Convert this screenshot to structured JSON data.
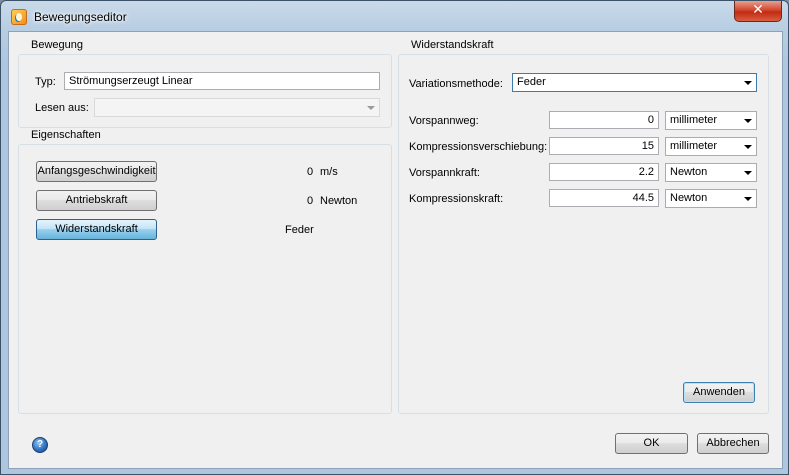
{
  "window": {
    "title": "Bewegungseditor",
    "close_glyph": "✕"
  },
  "bewegung": {
    "legend": "Bewegung",
    "typ_label": "Typ:",
    "typ_value": "Strömungserzeugt Linear",
    "lesen_label": "Lesen aus:",
    "lesen_value": ""
  },
  "eigenschaften": {
    "legend": "Eigenschaften",
    "rows": [
      {
        "button": "Anfangsgeschwindigkeit",
        "value": "0",
        "unit": "m/s"
      },
      {
        "button": "Antriebskraft",
        "value": "0",
        "unit": "Newton"
      },
      {
        "button": "Widerstandskraft",
        "value": "Feder"
      }
    ]
  },
  "widerstand": {
    "legend": "Widerstandskraft",
    "methode_label": "Variationsmethode:",
    "methode_value": "Feder",
    "fields": [
      {
        "label": "Vorspannweg:",
        "value": "0",
        "unit": "millimeter"
      },
      {
        "label": "Kompressionsverschiebung:",
        "value": "15",
        "unit": "millimeter"
      },
      {
        "label": "Vorspannkraft:",
        "value": "2.2",
        "unit": "Newton"
      },
      {
        "label": "Kompressionskraft:",
        "value": "44.5",
        "unit": "Newton"
      }
    ],
    "apply_button": "Anwenden"
  },
  "footer": {
    "help_glyph": "?",
    "ok_button": "OK",
    "cancel_button": "Abbrechen"
  },
  "icons": {
    "app": "app-logo-icon",
    "close": "close-icon",
    "help": "help-icon",
    "dropdown": "chevron-down-icon"
  }
}
